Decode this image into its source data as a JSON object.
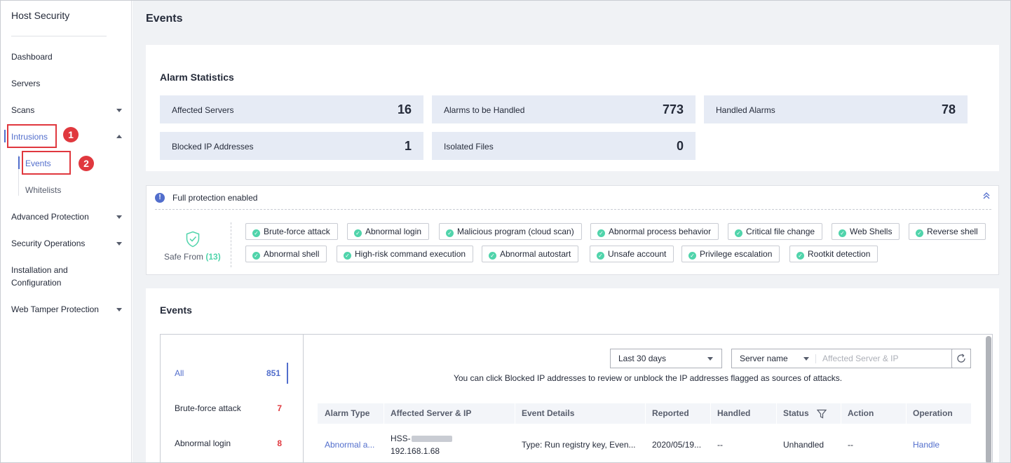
{
  "sidebar": {
    "title": "Host Security",
    "items": [
      {
        "label": "Dashboard"
      },
      {
        "label": "Servers"
      },
      {
        "label": "Scans"
      },
      {
        "label": "Intrusions"
      },
      {
        "label": "Advanced Protection"
      },
      {
        "label": "Security Operations"
      },
      {
        "label": "Installation and",
        "label2": "Configuration"
      },
      {
        "label": "Web Tamper Protection"
      }
    ],
    "subitems": [
      {
        "label": "Events"
      },
      {
        "label": "Whitelists"
      }
    ],
    "callouts": [
      "1",
      "2"
    ]
  },
  "page": {
    "title": "Events"
  },
  "alarm_stats": {
    "title": "Alarm Statistics",
    "items": [
      {
        "label": "Affected Servers",
        "value": "16"
      },
      {
        "label": "Alarms to be Handled",
        "value": "773"
      },
      {
        "label": "Handled Alarms",
        "value": "78"
      },
      {
        "label": "Blocked IP Addresses",
        "value": "1"
      },
      {
        "label": "Isolated Files",
        "value": "0"
      }
    ]
  },
  "protection": {
    "header": "Full protection enabled",
    "safe_from_label": "Safe From",
    "safe_from_count": "(13)",
    "status_color": "#50d4ab",
    "tags": [
      "Brute-force attack",
      "Abnormal login",
      "Malicious program (cloud scan)",
      "Abnormal process behavior",
      "Critical file change",
      "Web Shells",
      "Reverse shell",
      "Abnormal shell",
      "High-risk command execution",
      "Abnormal autostart",
      "Unsafe account",
      "Privilege escalation",
      "Rootkit detection"
    ]
  },
  "events": {
    "title": "Events",
    "categories": [
      {
        "label": "All",
        "count": "851"
      },
      {
        "label": "Brute-force attack",
        "count": "7"
      },
      {
        "label": "Abnormal login",
        "count": "8"
      }
    ],
    "time_filter": "Last 30 days",
    "search_field": "Server name",
    "search_placeholder": "Affected Server & IP",
    "hint": "You can click Blocked IP addresses to review or unblock the IP addresses flagged as sources of attacks.",
    "columns": [
      "Alarm Type",
      "Affected Server & IP",
      "Event Details",
      "Reported",
      "Handled",
      "Status",
      "Action",
      "Operation"
    ],
    "rows": [
      {
        "alarm_type": "Abnormal a...",
        "server": "HSS-",
        "ip": "192.168.1.68",
        "details": "Type: Run registry key, Even...",
        "reported": "2020/05/19...",
        "handled": "--",
        "status": "Unhandled",
        "action": "--",
        "operation": "Handle"
      }
    ]
  },
  "colors": {
    "accent": "#526ecc",
    "danger": "#e0383e",
    "success": "#50d4ab",
    "stat_bg": "#e6ebf5"
  }
}
